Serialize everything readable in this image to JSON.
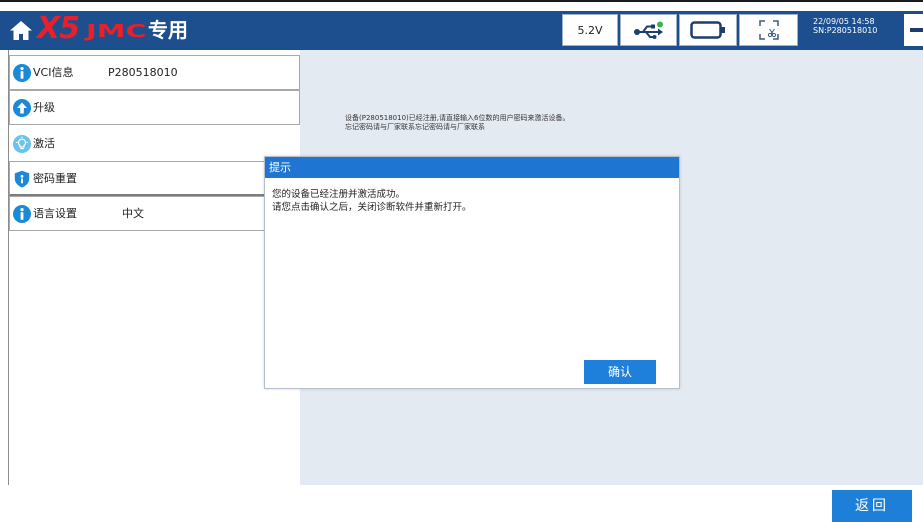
{
  "header": {
    "brand": {
      "model": "X5",
      "name": "JMC",
      "suffix": "专用"
    },
    "status": {
      "voltage": "5.2V",
      "datetime": "22/09/05 14:58",
      "serial": "SN:P280518010"
    },
    "icons": [
      "home-icon",
      "usb-icon",
      "battery-icon",
      "screenshot-icon",
      "minimize-icon"
    ]
  },
  "sidebar": {
    "items": [
      {
        "label": "VCI信息",
        "value": "P280518010",
        "icon": "info-icon"
      },
      {
        "label": "升级",
        "icon": "upgrade-icon"
      },
      {
        "label": "激活",
        "icon": "lightbulb-icon"
      },
      {
        "label": "密码重置",
        "icon": "shield-icon"
      },
      {
        "label": "语言设置",
        "value": "中文",
        "icon": "info-icon"
      }
    ]
  },
  "main": {
    "notice": {
      "line1": "设备(P280518010)已经注册,请直接输入6位数的用户密码来激活设备。",
      "line2": "忘记密码请与厂家联系忘记密码请与厂家联系"
    }
  },
  "dialog": {
    "title": "提示",
    "message": [
      "您的设备已经注册并激活成功。",
      "请您点击确认之后，关闭诊断软件并重新打开。"
    ],
    "confirm_label": "确认"
  },
  "footer": {
    "back_label": "返回"
  },
  "colors": {
    "header_bg": "#1d4f8e",
    "brand_red": "#e8202a",
    "accent_blue": "#1f78d4",
    "main_bg": "#e4eaf2",
    "usb_status_green": "#3bb54a"
  }
}
